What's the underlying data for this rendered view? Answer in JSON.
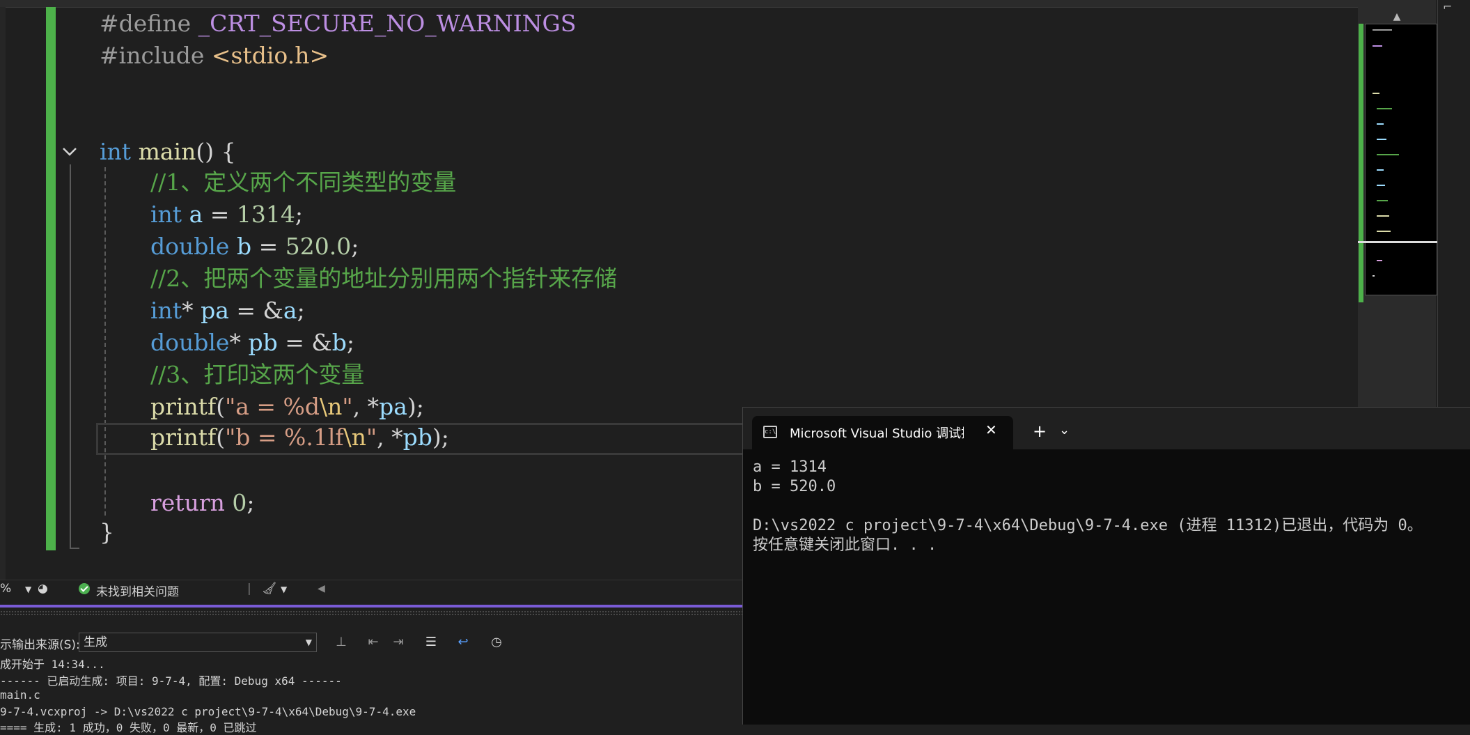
{
  "editor": {
    "lines": {
      "define_kw": "#define",
      "define_name": "_CRT_SECURE_NO_WARNINGS",
      "include_kw": "#include",
      "include_file": "<stdio.h>",
      "main_type": "int",
      "main_name": "main",
      "main_rest": "() {",
      "comment1": "//1、定义两个不同类型的变量",
      "int_kw": "int",
      "int_var": "a",
      "int_eq": " = ",
      "int_val": "1314",
      "semi": ";",
      "double_kw": "double",
      "double_var": "b",
      "double_val": "520.0",
      "comment2": "//2、把两个变量的地址分别用两个指针来存储",
      "intptr_kw": "int",
      "star": "*",
      "pa": "pa",
      "amp": " = &",
      "a": "a",
      "doubleptr_kw": "double",
      "pb": "pb",
      "b": "b",
      "comment3": "//3、打印这两个变量",
      "printf": "printf",
      "open": "(",
      "str1": "\"a = %d",
      "str2": "\"b = %.1lf",
      "esc_n": "\\n",
      "quote": "\"",
      "deref": ", *",
      "close": ");",
      "return_kw": "return",
      "return_val": "0",
      "brace": "}"
    }
  },
  "statusbar": {
    "zoom": "%",
    "issues": "未找到相关问题"
  },
  "output": {
    "source_label": "示输出来源(S):",
    "source_value": "生成",
    "lines": [
      "成开始于 14:34...",
      "------ 已启动生成: 项目: 9-7-4, 配置: Debug x64 ------",
      "main.c",
      "9-7-4.vcxproj -> D:\\vs2022 c project\\9-7-4\\x64\\Debug\\9-7-4.exe",
      "==== 生成: 1 成功，0 失败，0 最新，0 已跳过"
    ]
  },
  "terminal": {
    "title": "Microsoft Visual Studio 调试控制台",
    "body": "a = 1314\nb = 520.0\n\nD:\\vs2022 c project\\9-7-4\\x64\\Debug\\9-7-4.exe (进程 11312)已退出，代码为 0。\n按任意键关闭此窗口. . ."
  },
  "colors": {
    "change_bar": "#4db14a",
    "keyword": "#569cd6",
    "comment": "#57a64a",
    "output_accent": "#7a5bd6"
  }
}
